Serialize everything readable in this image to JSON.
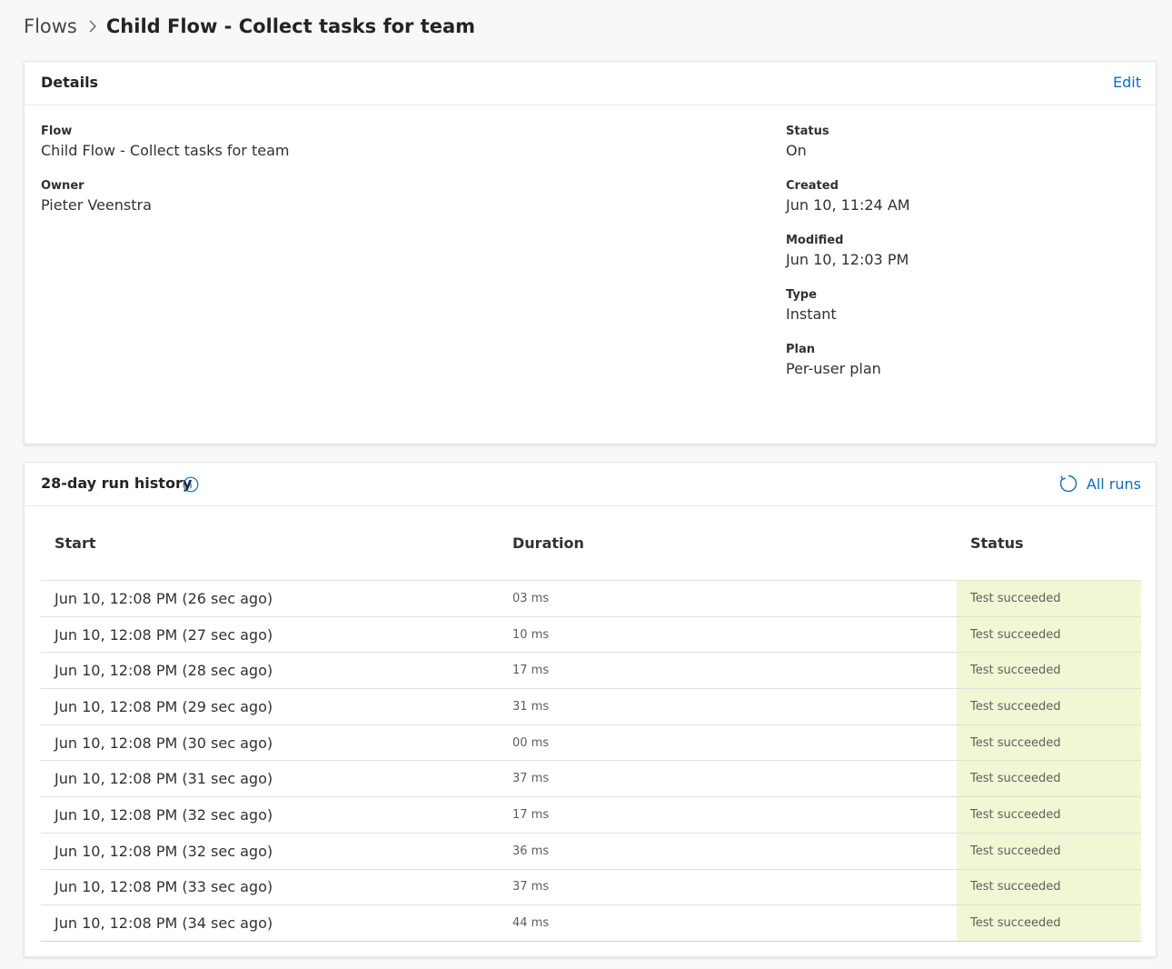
{
  "breadcrumb": {
    "root": "Flows",
    "current": "Child Flow - Collect tasks for team"
  },
  "details": {
    "title": "Details",
    "edit_label": "Edit",
    "left_fields": [
      {
        "label": "Flow",
        "value": "Child Flow - Collect tasks for team"
      },
      {
        "label": "Owner",
        "value": "Pieter Veenstra"
      }
    ],
    "right_fields": [
      {
        "label": "Status",
        "value": "On"
      },
      {
        "label": "Created",
        "value": "Jun 10, 11:24 AM"
      },
      {
        "label": "Modified",
        "value": "Jun 10, 12:03 PM"
      },
      {
        "label": "Type",
        "value": "Instant"
      },
      {
        "label": "Plan",
        "value": "Per-user plan"
      }
    ]
  },
  "run_history": {
    "title": "28-day run history",
    "all_runs_label": "All runs",
    "columns": {
      "start": "Start",
      "duration": "Duration",
      "status": "Status"
    },
    "rows": [
      {
        "start": "Jun 10, 12:08 PM (26 sec ago)",
        "duration": "03 ms",
        "status": "Test succeeded"
      },
      {
        "start": "Jun 10, 12:08 PM (27 sec ago)",
        "duration": "10 ms",
        "status": "Test succeeded"
      },
      {
        "start": "Jun 10, 12:08 PM (28 sec ago)",
        "duration": "17 ms",
        "status": "Test succeeded"
      },
      {
        "start": "Jun 10, 12:08 PM (29 sec ago)",
        "duration": "31 ms",
        "status": "Test succeeded"
      },
      {
        "start": "Jun 10, 12:08 PM (30 sec ago)",
        "duration": "00 ms",
        "status": "Test succeeded"
      },
      {
        "start": "Jun 10, 12:08 PM (31 sec ago)",
        "duration": "37 ms",
        "status": "Test succeeded"
      },
      {
        "start": "Jun 10, 12:08 PM (32 sec ago)",
        "duration": "17 ms",
        "status": "Test succeeded"
      },
      {
        "start": "Jun 10, 12:08 PM (32 sec ago)",
        "duration": "36 ms",
        "status": "Test succeeded"
      },
      {
        "start": "Jun 10, 12:08 PM (33 sec ago)",
        "duration": "37 ms",
        "status": "Test succeeded"
      },
      {
        "start": "Jun 10, 12:08 PM (34 sec ago)",
        "duration": "44 ms",
        "status": "Test succeeded"
      }
    ]
  },
  "colors": {
    "accent": "#0f6cbd",
    "success_bg": "#f0f7d4"
  },
  "icons": {
    "breadcrumb_separator": "chevron-right-icon",
    "info": "info-icon",
    "all_runs": "refresh-icon"
  }
}
